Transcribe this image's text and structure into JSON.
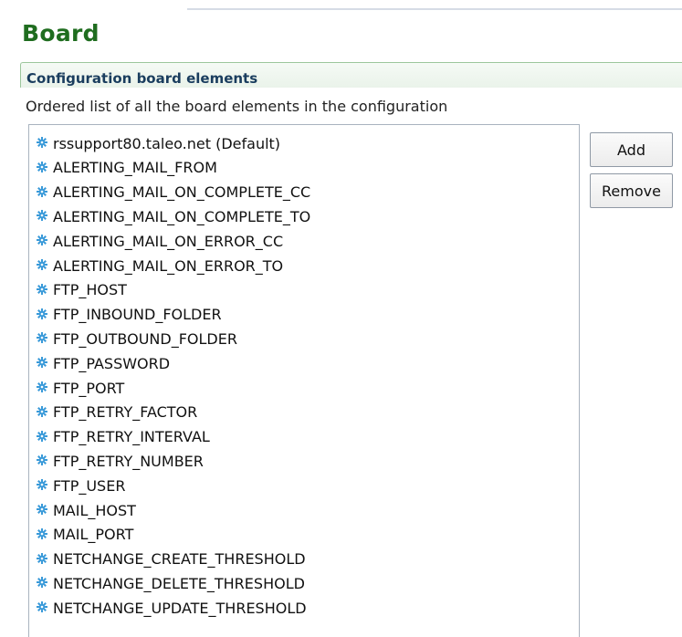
{
  "page": {
    "title": "Board"
  },
  "section": {
    "title": "Configuration board elements",
    "description": "Ordered list of all the board elements in the configuration"
  },
  "list": {
    "item_icon": "gear-icon",
    "items": [
      "rssupport80.taleo.net (Default)",
      "ALERTING_MAIL_FROM",
      "ALERTING_MAIL_ON_COMPLETE_CC",
      "ALERTING_MAIL_ON_COMPLETE_TO",
      "ALERTING_MAIL_ON_ERROR_CC",
      "ALERTING_MAIL_ON_ERROR_TO",
      "FTP_HOST",
      "FTP_INBOUND_FOLDER",
      "FTP_OUTBOUND_FOLDER",
      "FTP_PASSWORD",
      "FTP_PORT",
      "FTP_RETRY_FACTOR",
      "FTP_RETRY_INTERVAL",
      "FTP_RETRY_NUMBER",
      "FTP_USER",
      "MAIL_HOST",
      "MAIL_PORT",
      "NETCHANGE_CREATE_THRESHOLD",
      "NETCHANGE_DELETE_THRESHOLD",
      "NETCHANGE_UPDATE_THRESHOLD"
    ]
  },
  "buttons": {
    "add_label": "Add",
    "remove_label": "Remove"
  },
  "colors": {
    "title": "#1f6d1f",
    "section_title": "#1a3d5e",
    "section_border": "#9cc69c",
    "icon": "#3a9ad9"
  }
}
